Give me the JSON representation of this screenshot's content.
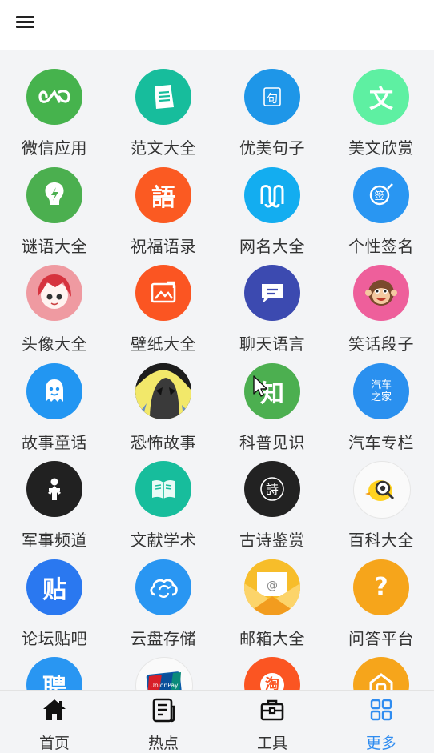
{
  "topbar": {
    "menu_icon": "hamburger-menu-icon"
  },
  "tiles": [
    {
      "label": "微信应用",
      "color": "#46b34d",
      "icon": "infinity-icon"
    },
    {
      "label": "范文大全",
      "color": "#17bd9c",
      "icon": "document-icon"
    },
    {
      "label": "优美句子",
      "color": "#1e96e8",
      "icon": "quote-icon",
      "glyph": "句"
    },
    {
      "label": "美文欣赏",
      "color": "#5ef0a2",
      "icon": "wen-character-icon",
      "glyph": "文"
    },
    {
      "label": "谜语大全",
      "color": "#4baf4f",
      "icon": "lightbulb-icon"
    },
    {
      "label": "祝福语录",
      "color": "#fb5a22",
      "icon": "yu-character-icon",
      "glyph": "語"
    },
    {
      "label": "网名大全",
      "color": "#13adf0",
      "icon": "mm-logo-icon"
    },
    {
      "label": "个性签名",
      "color": "#2996f2",
      "icon": "signature-icon",
      "glyph": "签"
    },
    {
      "label": "头像大全",
      "color": "#ef9aa1",
      "icon": "anime-avatar-icon"
    },
    {
      "label": "壁纸大全",
      "color": "#fb5522",
      "icon": "picture-icon"
    },
    {
      "label": "聊天语言",
      "color": "#3c4ab0",
      "icon": "chat-bubble-icon"
    },
    {
      "label": "笑话段子",
      "color": "#ee5f9b",
      "icon": "monkey-face-icon"
    },
    {
      "label": "故事童话",
      "color": "#2296f2",
      "icon": "ghost-icon"
    },
    {
      "label": "恐怖故事",
      "color": "#2b2b2b",
      "icon": "horror-portrait-icon"
    },
    {
      "label": "科普见识",
      "color": "#4caf50",
      "icon": "zhi-character-icon",
      "glyph": "知"
    },
    {
      "label": "汽车专栏",
      "color": "#2a90ef",
      "icon": "autohome-logo-icon",
      "glyph": "汽车之家"
    },
    {
      "label": "军事频道",
      "color": "#212121",
      "icon": "soldier-icon"
    },
    {
      "label": "文献学术",
      "color": "#17bd9c",
      "icon": "open-book-icon"
    },
    {
      "label": "古诗鉴赏",
      "color": "#222222",
      "icon": "poem-seal-icon",
      "glyph": "詩"
    },
    {
      "label": "百科大全",
      "color": "#fafafa",
      "icon": "magnifier-bird-icon"
    },
    {
      "label": "论坛贴吧",
      "color": "#2a78f0",
      "icon": "tieba-icon",
      "glyph": "贴"
    },
    {
      "label": "云盘存储",
      "color": "#2996f2",
      "icon": "cloud-sync-icon"
    },
    {
      "label": "邮箱大全",
      "color": "#f7bd2a",
      "icon": "envelope-icon"
    },
    {
      "label": "问答平台",
      "color": "#f6a51b",
      "icon": "question-icon",
      "glyph": "?"
    },
    {
      "label": "",
      "color": "#2996f2",
      "icon": "pin-character-icon",
      "glyph": "聘"
    },
    {
      "label": "",
      "color": "#fafafa",
      "icon": "unionpay-card-icon"
    },
    {
      "label": "",
      "color": "#fb5522",
      "icon": "taobao-icon",
      "glyph": "淘"
    },
    {
      "label": "",
      "color": "#f6a51b",
      "icon": "house-icon"
    }
  ],
  "tabbar": {
    "tabs": [
      {
        "label": "首页",
        "icon": "home-icon",
        "active": false
      },
      {
        "label": "热点",
        "icon": "news-icon",
        "active": false
      },
      {
        "label": "工具",
        "icon": "toolbox-icon",
        "active": false
      },
      {
        "label": "更多",
        "icon": "grid-icon",
        "active": true
      }
    ],
    "active_color": "#2f8cf0"
  }
}
